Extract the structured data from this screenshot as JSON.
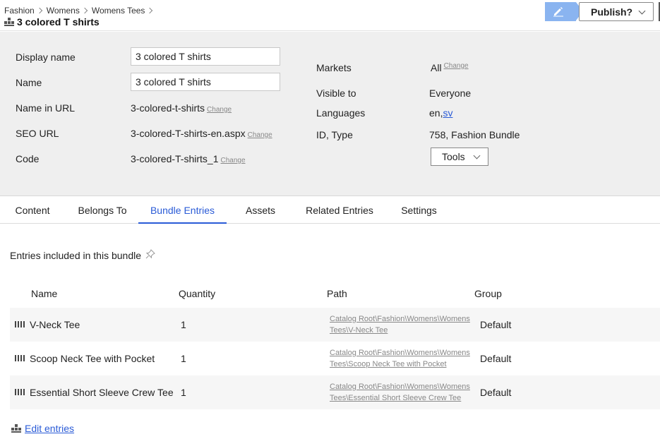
{
  "breadcrumb": [
    "Fashion",
    "Womens",
    "Womens Tees"
  ],
  "page_title": "3 colored T shirts",
  "toolbar": {
    "publish_label": "Publish?"
  },
  "properties": {
    "display_name_label": "Display name",
    "display_name_value": "3 colored T shirts",
    "name_label": "Name",
    "name_value": "3 colored T shirts",
    "name_in_url_label": "Name in URL",
    "name_in_url_value": "3-colored-t-shirts",
    "seo_url_label": "SEO URL",
    "seo_url_value": "3-colored-T-shirts-en.aspx",
    "code_label": "Code",
    "code_value": "3-colored-T-shirts_1",
    "change_label": "Change",
    "markets_label": "Markets",
    "markets_value": "All",
    "visible_to_label": "Visible to",
    "visible_to_value": "Everyone",
    "languages_label": "Languages",
    "languages_value_prefix": "en,",
    "languages_value_link": "sv",
    "id_type_label": "ID, Type",
    "id_type_value": "758, Fashion Bundle",
    "tools_label": "Tools"
  },
  "tabs": [
    {
      "label": "Content",
      "active": false
    },
    {
      "label": "Belongs To",
      "active": false
    },
    {
      "label": "Bundle Entries",
      "active": true
    },
    {
      "label": "Assets",
      "active": false
    },
    {
      "label": "Related Entries",
      "active": false
    },
    {
      "label": "Settings",
      "active": false
    }
  ],
  "bundle": {
    "section_title": "Entries included in this bundle",
    "columns": [
      "Name",
      "Quantity",
      "Path",
      "Group"
    ],
    "rows": [
      {
        "name": "V-Neck Tee",
        "quantity": "1",
        "path_line1": "Catalog Root\\Fashion\\Womens\\Womens",
        "path_line2": "Tees\\V-Neck Tee",
        "group": "Default"
      },
      {
        "name": "Scoop Neck Tee with Pocket",
        "quantity": "1",
        "path_line1": "Catalog Root\\Fashion\\Womens\\Womens",
        "path_line2": "Tees\\Scoop Neck Tee with Pocket",
        "group": "Default"
      },
      {
        "name": "Essential Short Sleeve Crew Tee",
        "quantity": "1",
        "path_line1": "Catalog Root\\Fashion\\Womens\\Womens",
        "path_line2": "Tees\\Essential Short Sleeve Crew Tee",
        "group": "Default"
      }
    ],
    "edit_entries_label": "Edit entries"
  },
  "colors": {
    "accent": "#2a5bd7",
    "edit_button": "#8ab4f0",
    "panel_bg": "#efefef"
  },
  "icons": {
    "title": "bundle-icon",
    "edit": "pencil-icon",
    "pin": "pin-icon",
    "row": "variant-icon"
  }
}
